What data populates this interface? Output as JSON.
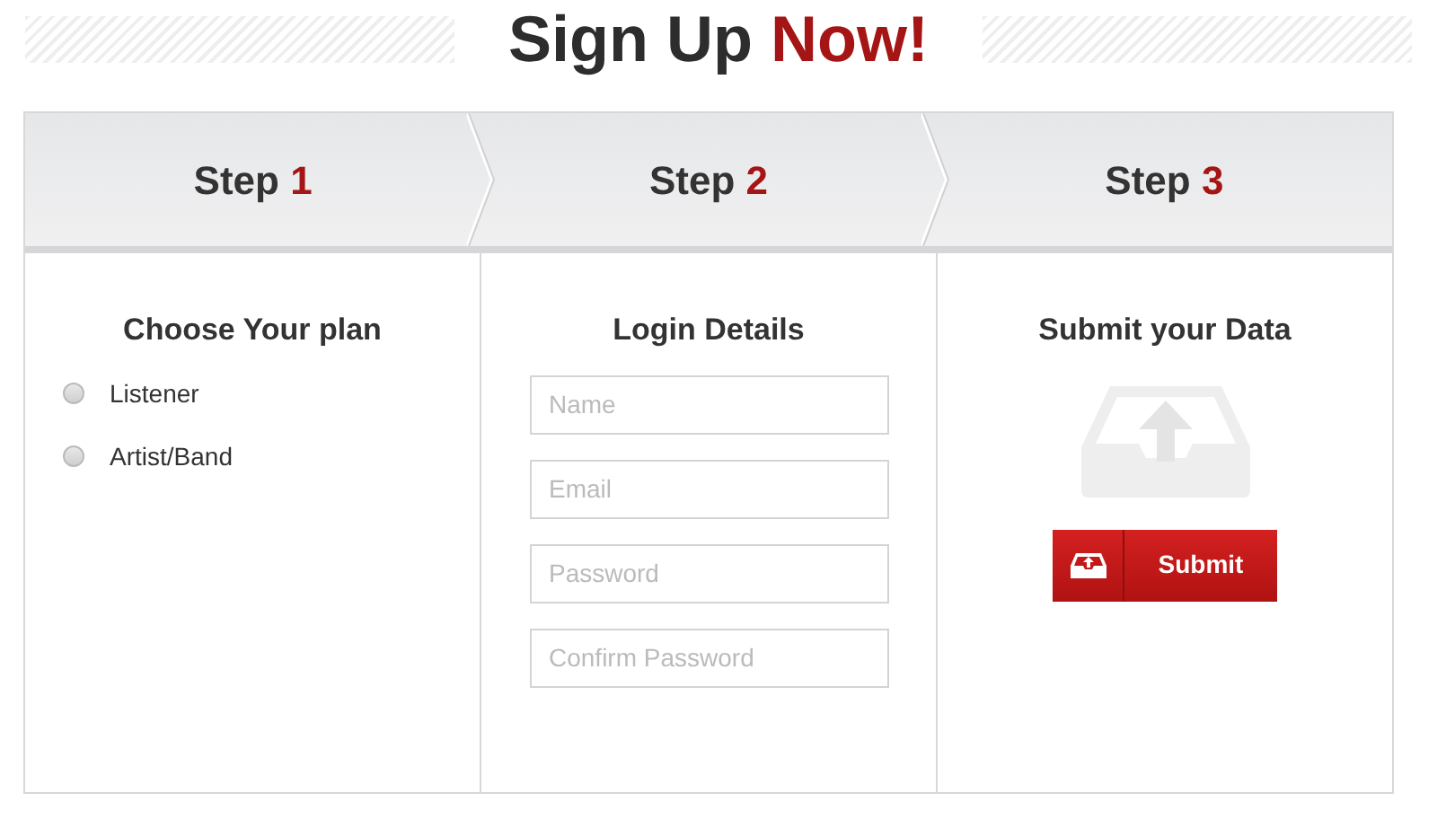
{
  "title": {
    "text": "Sign Up",
    "accent": "Now!"
  },
  "steps": [
    {
      "label": "Step",
      "number": "1"
    },
    {
      "label": "Step",
      "number": "2"
    },
    {
      "label": "Step",
      "number": "3"
    }
  ],
  "plan": {
    "heading": "Choose Your plan",
    "options": [
      {
        "label": "Listener",
        "selected": false
      },
      {
        "label": "Artist/Band",
        "selected": false
      }
    ]
  },
  "login": {
    "heading": "Login Details",
    "fields": [
      {
        "placeholder": "Name"
      },
      {
        "placeholder": "Email"
      },
      {
        "placeholder": "Password"
      },
      {
        "placeholder": "Confirm Password"
      }
    ]
  },
  "submit": {
    "heading": "Submit your Data",
    "button": "Submit"
  }
}
